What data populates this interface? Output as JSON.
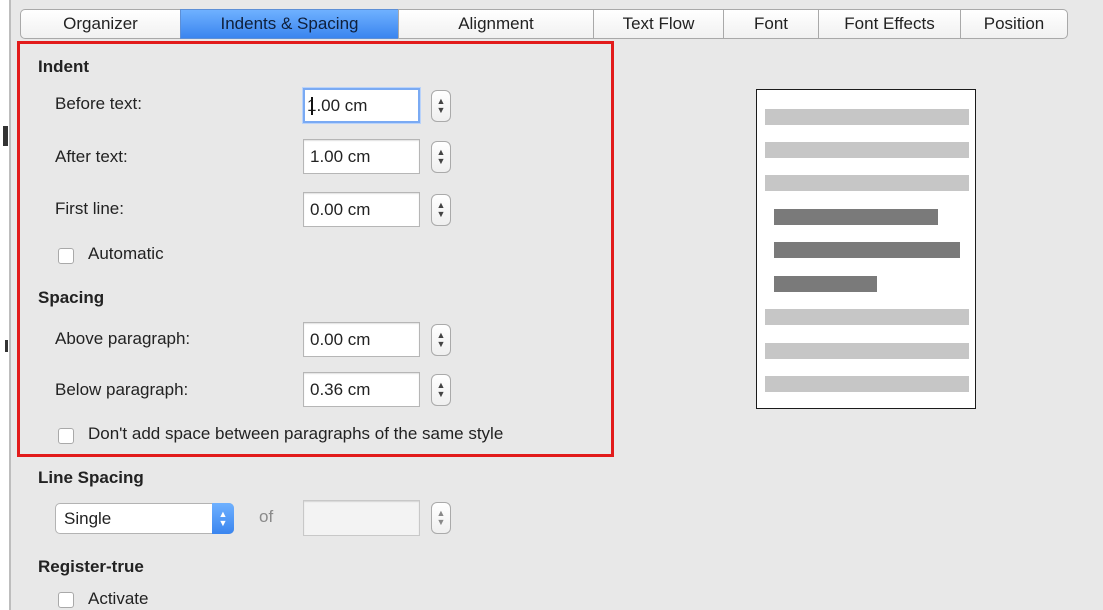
{
  "tabs": [
    {
      "label": "Organizer",
      "active": false
    },
    {
      "label": "Indents & Spacing",
      "active": true
    },
    {
      "label": "Alignment",
      "active": false
    },
    {
      "label": "Text Flow",
      "active": false
    },
    {
      "label": "Font",
      "active": false
    },
    {
      "label": "Font Effects",
      "active": false
    },
    {
      "label": "Position",
      "active": false
    }
  ],
  "indent": {
    "heading": "Indent",
    "before_text": {
      "label": "Before text:",
      "value": "1.00 cm"
    },
    "after_text": {
      "label": "After text:",
      "value": "1.00 cm"
    },
    "first_line": {
      "label": "First line:",
      "value": "0.00 cm"
    },
    "automatic": {
      "label": "Automatic",
      "checked": false
    }
  },
  "spacing": {
    "heading": "Spacing",
    "above_paragraph": {
      "label": "Above paragraph:",
      "value": "0.00 cm"
    },
    "below_paragraph": {
      "label": "Below paragraph:",
      "value": "0.36 cm"
    },
    "dont_add_space": {
      "label": "Don't add space between paragraphs of the same style",
      "checked": false
    }
  },
  "line_spacing": {
    "heading": "Line Spacing",
    "selected": "Single",
    "of_label": "of",
    "value": ""
  },
  "register_true": {
    "heading": "Register-true",
    "activate": {
      "label": "Activate",
      "checked": false
    }
  },
  "colors": {
    "highlight_border": "#e21b1b",
    "active_tab": "#4a93f5"
  }
}
